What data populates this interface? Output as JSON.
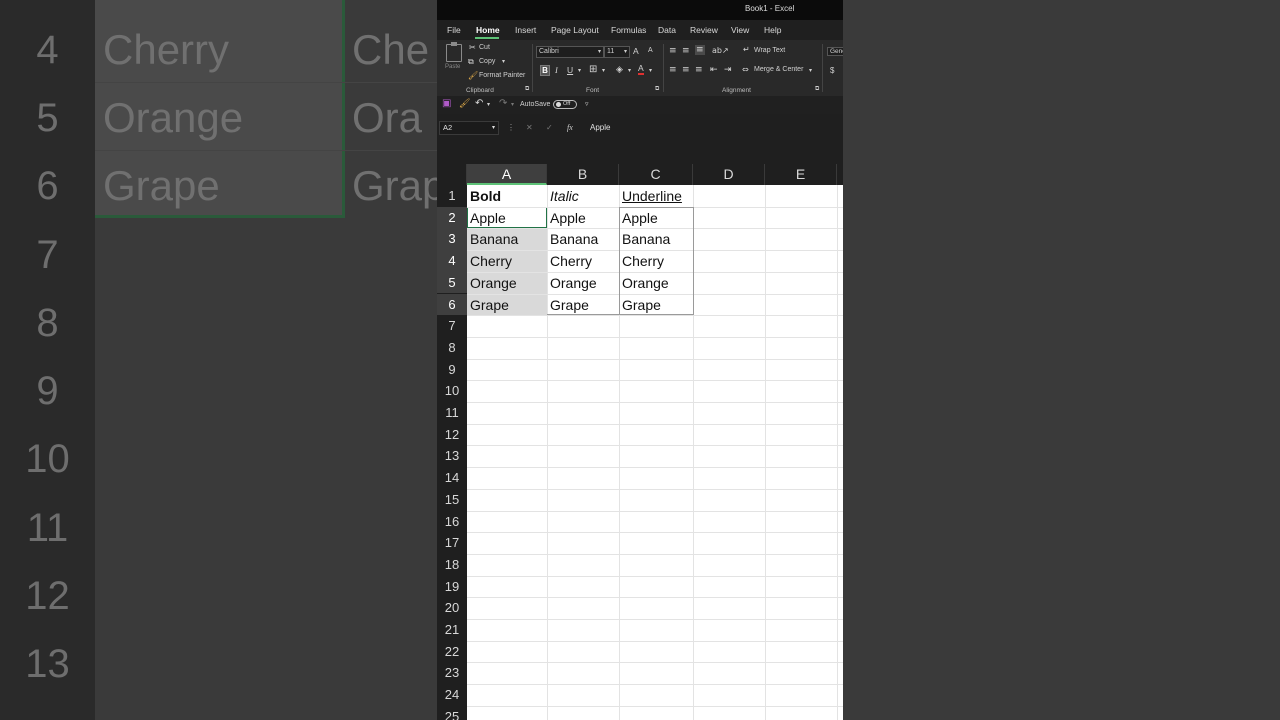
{
  "background": {
    "row_numbers": [
      "4",
      "5",
      "6",
      "7",
      "8",
      "9",
      "10",
      "11",
      "12",
      "13"
    ],
    "col_a": [
      "Cherry",
      "Orange",
      "Grape"
    ],
    "col_b": [
      "Che",
      "Ora",
      "Grap"
    ]
  },
  "window": {
    "title": "Book1  -  Excel"
  },
  "tabs": [
    "File",
    "Home",
    "Insert",
    "Page Layout",
    "Formulas",
    "Data",
    "Review",
    "View",
    "Help"
  ],
  "active_tab": "Home",
  "ribbon": {
    "clipboard": {
      "paste": "Paste",
      "cut": "Cut",
      "copy": "Copy",
      "format_painter": "Format Painter",
      "group": "Clipboard"
    },
    "font": {
      "name": "Calibri",
      "size": "11",
      "bold": "B",
      "italic": "I",
      "underline": "U",
      "grow": "A",
      "shrink": "A",
      "font_color": "A",
      "group": "Font"
    },
    "alignment": {
      "wrap": "Wrap Text",
      "merge": "Merge & Center",
      "group": "Alignment"
    },
    "number": {
      "format": "Gene",
      "currency": "$"
    }
  },
  "qat": {
    "autosave_label": "AutoSave",
    "autosave_state": "Off"
  },
  "formula_bar": {
    "name_box": "A2",
    "cancel": "✕",
    "enter": "✓",
    "fx": "fx",
    "value": "Apple"
  },
  "columns": [
    "A",
    "B",
    "C",
    "D",
    "E"
  ],
  "rows": [
    "1",
    "2",
    "3",
    "4",
    "5",
    "6",
    "7",
    "8",
    "9",
    "10",
    "11",
    "12",
    "13",
    "14",
    "15",
    "16",
    "17",
    "18",
    "19",
    "20",
    "21",
    "22",
    "23",
    "24",
    "25"
  ],
  "sheet": {
    "headers": [
      "Bold",
      "Italic",
      "Underline"
    ],
    "a": [
      "Apple",
      "Banana",
      "Cherry",
      "Orange",
      "Grape"
    ],
    "b": [
      "Apple",
      "Banana",
      "Cherry",
      "Orange",
      "Grape"
    ],
    "c": [
      "Apple",
      "Banana",
      "Cherry",
      "Orange",
      "Grape"
    ]
  },
  "colors": {
    "accent": "#5ec277",
    "selection": "#d9d9d9",
    "dark_bg": "#1f1f1f"
  }
}
